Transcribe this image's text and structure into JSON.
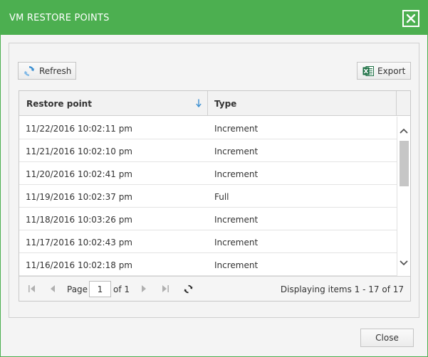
{
  "dialog": {
    "title": "VM RESTORE POINTS",
    "close_button_label": "Close"
  },
  "toolbar": {
    "refresh_label": "Refresh",
    "export_label": "Export"
  },
  "grid": {
    "columns": [
      "Restore point",
      "Type"
    ],
    "rows": [
      {
        "restore_point": "11/22/2016 10:02:11 pm",
        "type": "Increment"
      },
      {
        "restore_point": "11/21/2016 10:02:10 pm",
        "type": "Increment"
      },
      {
        "restore_point": "11/20/2016 10:02:41 pm",
        "type": "Increment"
      },
      {
        "restore_point": "11/19/2016 10:02:37 pm",
        "type": "Full"
      },
      {
        "restore_point": "11/18/2016 10:03:26 pm",
        "type": "Increment"
      },
      {
        "restore_point": "11/17/2016 10:02:43 pm",
        "type": "Increment"
      },
      {
        "restore_point": "11/16/2016 10:02:18 pm",
        "type": "Increment"
      }
    ]
  },
  "pager": {
    "page_label": "Page",
    "current_page": "1",
    "of_label": "of 1",
    "display_text": "Displaying items 1 - 17 of 17"
  },
  "colors": {
    "accent": "#4caf50",
    "refresh_icon": "#3b8fd1",
    "excel_icon": "#1e7145"
  },
  "icons": {
    "close": "close-icon",
    "refresh": "refresh-icon",
    "export": "excel-icon",
    "sort": "sort-down-arrow-icon"
  }
}
